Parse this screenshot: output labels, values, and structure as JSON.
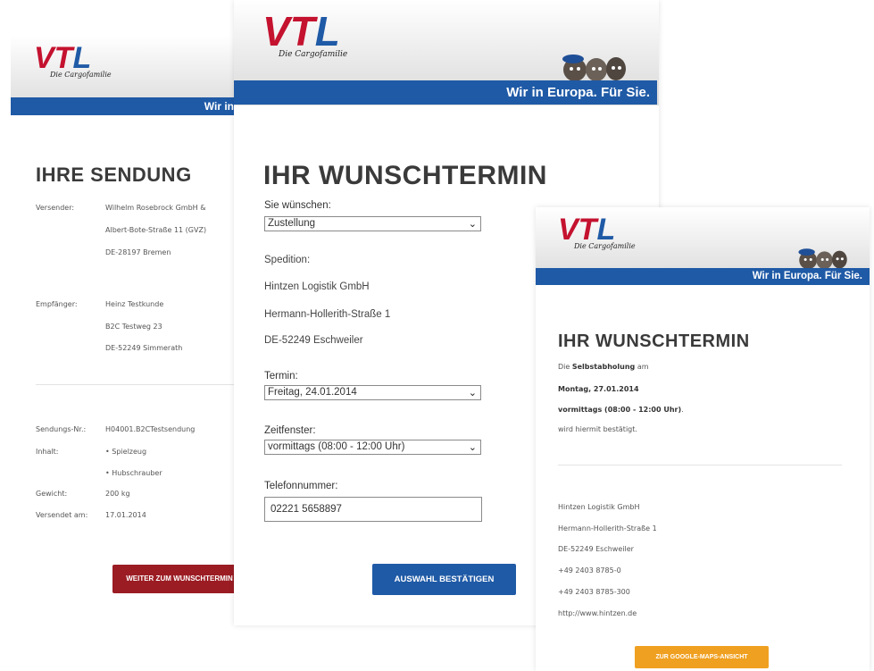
{
  "brand": {
    "logo": "VTL",
    "logo_vt": "VT",
    "logo_l": "L",
    "slogan": "Die Cargofamilie",
    "tagline": "Wir in Europa. Für Sie.",
    "tagline_partial": "Wir in",
    "colors": {
      "blue": "#1f5aa6",
      "red": "#c4122f",
      "orange": "#f0a020",
      "darkred": "#9b1c23"
    }
  },
  "screen1": {
    "title": "IHRE SENDUNG",
    "sender": {
      "label": "Versender:",
      "lines": [
        "Wilhelm Rosebrock GmbH &",
        "Albert-Bote-Straße 11 (GVZ)",
        "DE-28197 Bremen"
      ]
    },
    "recipient": {
      "label": "Empfänger:",
      "lines": [
        "Heinz Testkunde",
        "B2C Testweg 23",
        "DE-52249 Simmerath"
      ]
    },
    "shipment": {
      "number_label": "Sendungs-Nr.:",
      "number_value": "H04001.B2CTestsendung",
      "content_label": "Inhalt:",
      "content_items": [
        "• Spielzeug",
        "• Hubschrauber"
      ],
      "weight_label": "Gewicht:",
      "weight_value": "200 kg",
      "sent_label": "Versendet am:",
      "sent_value": "17.01.2014"
    },
    "button": "WEITER ZUM WUNSCHTERMIN"
  },
  "screen2": {
    "title": "IHR WUNSCHTERMIN",
    "wish_label": "Sie wünschen:",
    "wish_value": "Zustellung",
    "carrier_label": "Spedition:",
    "carrier_name": "Hintzen Logistik GmbH",
    "carrier_street": "Hermann-Hollerith-Straße 1",
    "carrier_city": "DE-52249 Eschweiler",
    "date_label": "Termin:",
    "date_value": "Freitag, 24.01.2014",
    "window_label": "Zeitfenster:",
    "window_value": "vormittags (08:00 - 12:00 Uhr)",
    "phone_label": "Telefonnummer:",
    "phone_value": "02221 5658897",
    "button": "AUSWAHL BESTÄTIGEN"
  },
  "screen3": {
    "title": "IHR WUNSCHTERMIN",
    "line1_pre": "Die",
    "line1_bold": "Selbstabholung",
    "line1_post": "am",
    "line2": "Montag, 27.01.2014",
    "line3_bold": "vormittags (08:00 - 12:00 Uhr)",
    "line3_post": ".",
    "line4": "wird hiermit bestätigt.",
    "contact": [
      "Hintzen Logistik GmbH",
      "Hermann-Hollerith-Straße 1",
      "DE-52249 Eschweiler",
      "+49 2403 8785-0",
      "+49 2403 8785-300",
      "http://www.hintzen.de"
    ],
    "button": "ZUR GOOGLE-MAPS-ANSICHT"
  }
}
